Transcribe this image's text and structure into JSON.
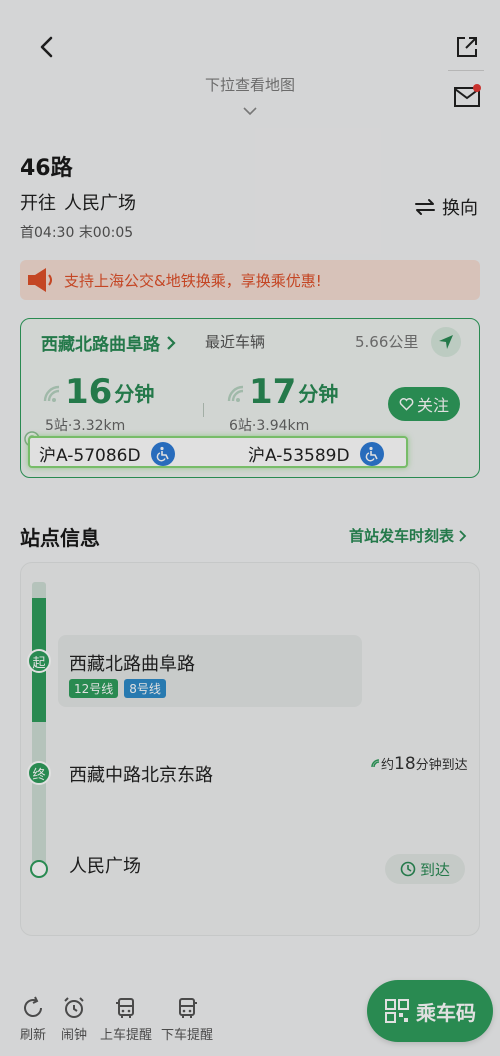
{
  "header": {
    "pull_hint": "下拉查看地图"
  },
  "route": {
    "name": "46路",
    "direction_prefix": "开往",
    "destination": "人民广场",
    "first_bus": "首04:30",
    "last_bus": "末00:05",
    "switch_label": "换向"
  },
  "promo": {
    "text": "支持上海公交&地铁换乘，享换乘优惠!"
  },
  "bus_card": {
    "stop_name": "西藏北路曲阜路",
    "nearest_label": "最近车辆",
    "distance": "5.66公里",
    "follow_label": "关注",
    "buses": [
      {
        "eta_num": "16",
        "eta_unit": "分钟",
        "detail": "5站·3.32km",
        "plate": "沪A-57086D"
      },
      {
        "eta_num": "17",
        "eta_unit": "分钟",
        "detail": "6站·3.94km",
        "plate": "沪A-53589D"
      }
    ]
  },
  "stations": {
    "title": "站点信息",
    "timetable_label": "首站发车时刻表",
    "items": [
      {
        "badge": "起",
        "name": "西藏北路曲阜路",
        "tags": [
          "12号线",
          "8号线"
        ]
      },
      {
        "badge": "终",
        "name": "西藏中路北京东路",
        "eta_prefix": "约",
        "eta_value": "18",
        "eta_suffix": "分钟到达"
      },
      {
        "badge": "",
        "name": "人民广场",
        "action": "到达"
      }
    ]
  },
  "colors": {
    "brand_green": "#2f9e5d",
    "line_12": "#2f9e5d",
    "line_8": "#2e8bc9",
    "promo_orange": "#e0502a",
    "accessibility_blue": "#2e7bd6"
  },
  "toolbar": {
    "refresh": "刷新",
    "alarm": "闹钟",
    "board_alert": "上车提醒",
    "alight_alert": "下车提醒",
    "ride_code": "乘车码"
  }
}
